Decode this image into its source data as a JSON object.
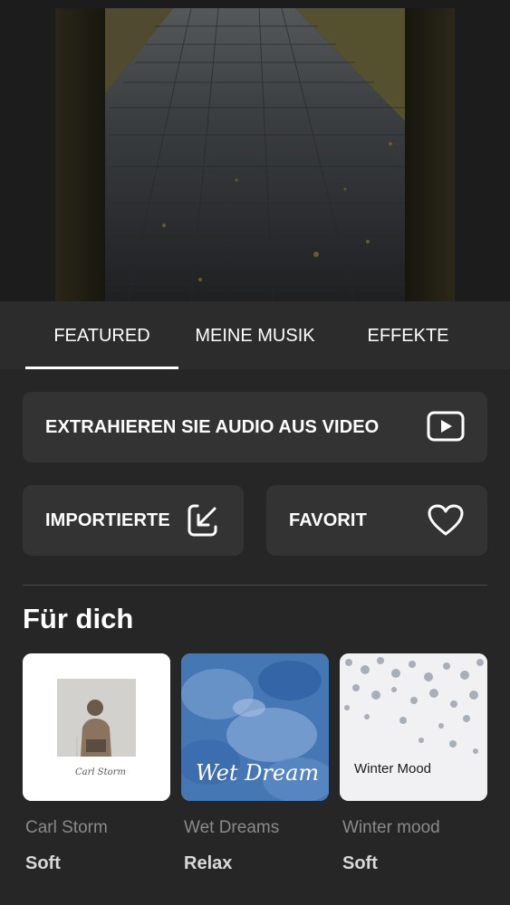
{
  "tabs": [
    {
      "label": "FEATURED",
      "active": true
    },
    {
      "label": "MEINE MUSIK",
      "active": false
    },
    {
      "label": "EFFEKTE",
      "active": false
    }
  ],
  "actions": {
    "extract_audio": {
      "label": "EXTRAHIEREN SIE AUDIO AUS VIDEO",
      "icon": "play-video-icon"
    },
    "imported": {
      "label": "IMPORTIERTE",
      "icon": "import-arrow-icon"
    },
    "favorite": {
      "label": "FAVORIT",
      "icon": "heart-icon"
    }
  },
  "section": {
    "title": "Für dich"
  },
  "albums": [
    {
      "cover_signature": "Carl Storm",
      "artist": "Carl Storm",
      "genre": "Soft"
    },
    {
      "cover_text": "Wet Dream",
      "artist": "Wet Dreams",
      "genre": "Relax"
    },
    {
      "cover_text": "Winter Mood",
      "artist": "Winter mood",
      "genre": "Soft"
    }
  ],
  "colors": {
    "background": "#262626",
    "card": "#333333",
    "tab_bar": "#2c2c2c",
    "accent": "#ffffff",
    "muted_text": "#8a8a8a"
  }
}
